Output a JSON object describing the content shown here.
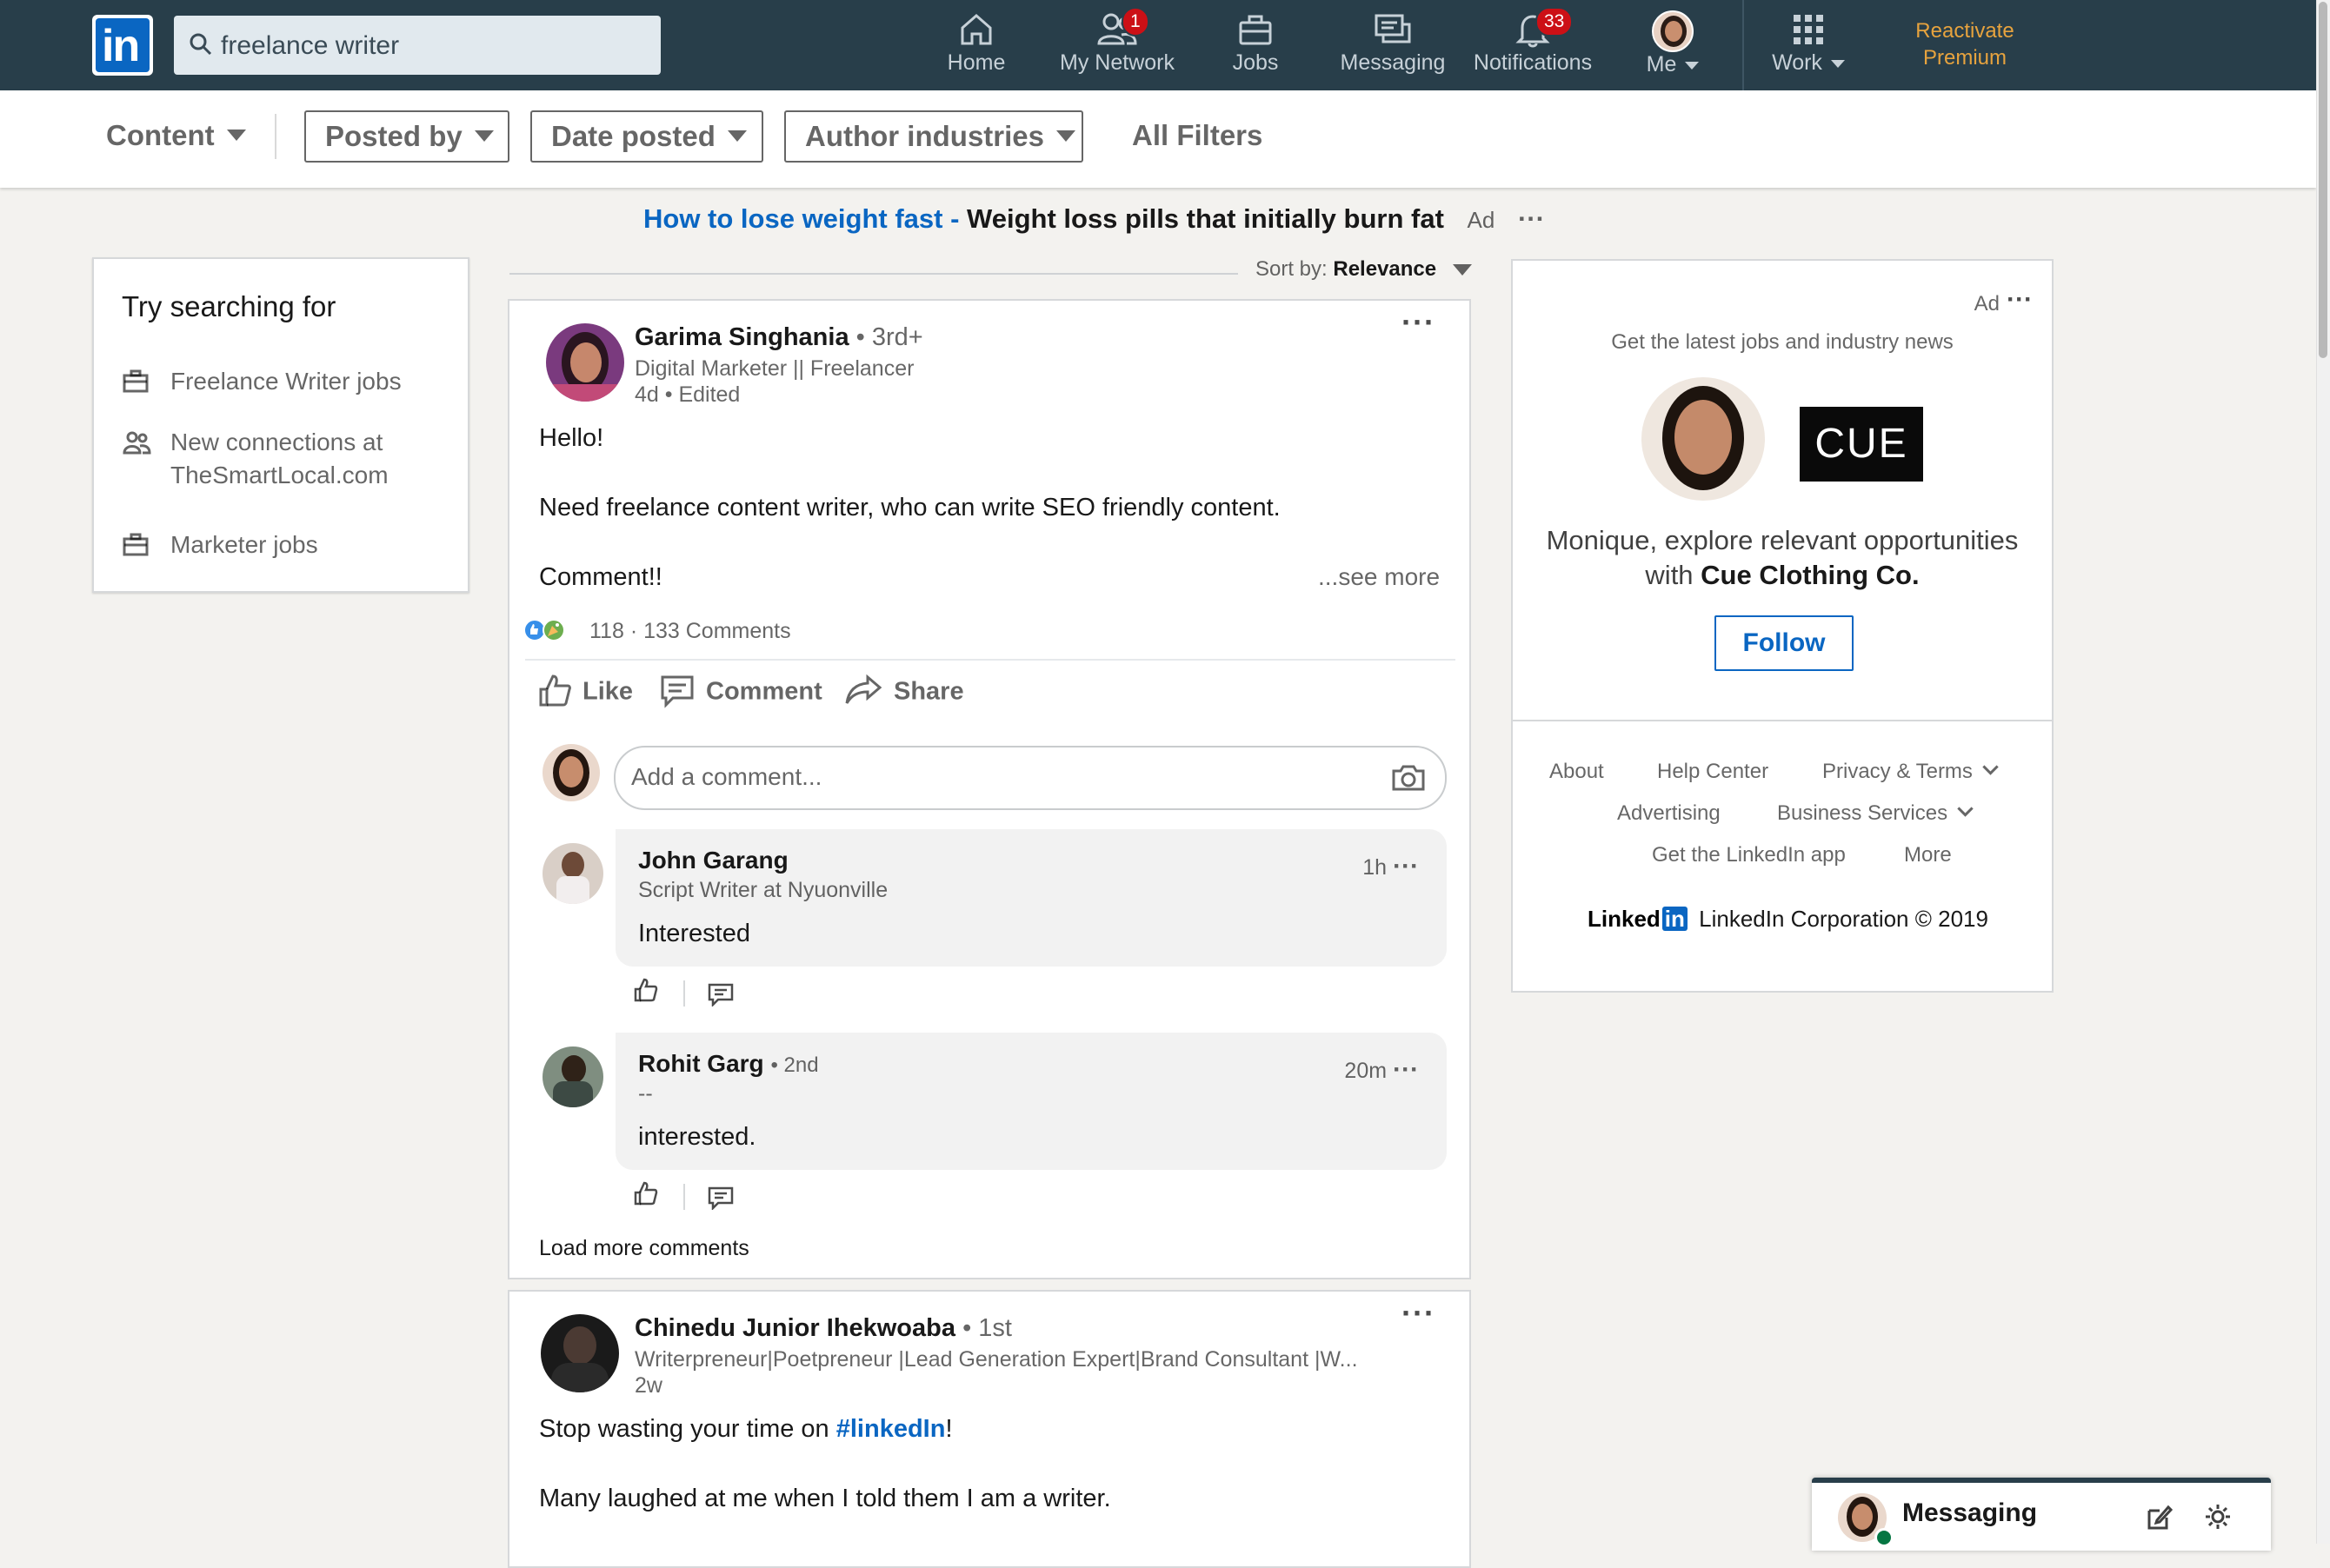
{
  "topnav": {
    "search_value": "freelance writer",
    "items": [
      {
        "label": "Home",
        "icon": "home-icon"
      },
      {
        "label": "My Network",
        "icon": "network-icon",
        "badge": "1"
      },
      {
        "label": "Jobs",
        "icon": "jobs-icon"
      },
      {
        "label": "Messaging",
        "icon": "messaging-icon"
      },
      {
        "label": "Notifications",
        "icon": "bell-icon",
        "badge": "33"
      },
      {
        "label": "Me",
        "icon": "avatar"
      },
      {
        "label": "Work",
        "icon": "grid-icon"
      }
    ],
    "premium_line1": "Reactivate",
    "premium_line2": "Premium",
    "colors": {
      "bar": "#283e4a",
      "brand": "#0a66c2",
      "badge": "#cc1016",
      "premium": "#e7a33e"
    }
  },
  "filters": {
    "content": "Content",
    "posted_by": "Posted by",
    "date_posted": "Date posted",
    "author_industries": "Author industries",
    "all_filters": "All Filters"
  },
  "ad_banner": {
    "link": "How to lose weight fast -",
    "text": "Weight loss pills that initially burn fat",
    "ad": "Ad",
    "dots": "···"
  },
  "sidebar": {
    "title": "Try searching for",
    "items": [
      {
        "line1": "Freelance Writer jobs",
        "line2": ""
      },
      {
        "line1": "New connections at",
        "line2": "TheSmartLocal.com"
      },
      {
        "line1": "Marketer jobs",
        "line2": ""
      }
    ]
  },
  "sort": {
    "label": "Sort by:",
    "value": "Relevance"
  },
  "post1": {
    "author": "Garima Singhania",
    "degree": "• 3rd+",
    "headline": "Digital Marketer || Freelancer",
    "meta": "4d • Edited",
    "lines": [
      "Hello!",
      "Need freelance content writer, who can write SEO friendly content.",
      "Comment!!"
    ],
    "see_more": "...see more",
    "reactions": "118",
    "comments_count": "· 133 Comments",
    "actions": {
      "like": "Like",
      "comment": "Comment",
      "share": "Share"
    },
    "add_comment_placeholder": "Add a comment...",
    "comments": [
      {
        "name": "John Garang",
        "degree": "",
        "headline": "Script Writer at Nyuonville",
        "time": "1h",
        "text": "Interested"
      },
      {
        "name": "Rohit Garg",
        "degree": "• 2nd",
        "headline": "--",
        "time": "20m",
        "text": "interested."
      }
    ],
    "load_more": "Load more comments"
  },
  "post2": {
    "author": "Chinedu Junior Ihekwoaba",
    "degree": "• 1st",
    "headline": "Writerpreneur|Poetpreneur |Lead Generation Expert|Brand Consultant |W...",
    "meta": "2w",
    "line1_prefix": "Stop wasting your time on ",
    "line1_hashtag": "#linkedIn",
    "line1_suffix": "!",
    "line2": "Many laughed at me when I told them I am a writer."
  },
  "right_ad": {
    "ad": "Ad",
    "dots": "···",
    "tagline": "Get the latest jobs and industry news",
    "company_logo_text": "CUE",
    "message_prefix": "Monique, explore relevant opportunities",
    "message_with": "with ",
    "company": "Cue Clothing Co.",
    "follow": "Follow"
  },
  "footer": {
    "about": "About",
    "help": "Help Center",
    "privacy": "Privacy & Terms",
    "advertising": "Advertising",
    "business": "Business Services",
    "app": "Get the LinkedIn app",
    "more": "More",
    "brand_word": "Linked",
    "brand_in": "in",
    "copyright": "LinkedIn Corporation © 2019"
  },
  "messaging": {
    "title": "Messaging"
  }
}
